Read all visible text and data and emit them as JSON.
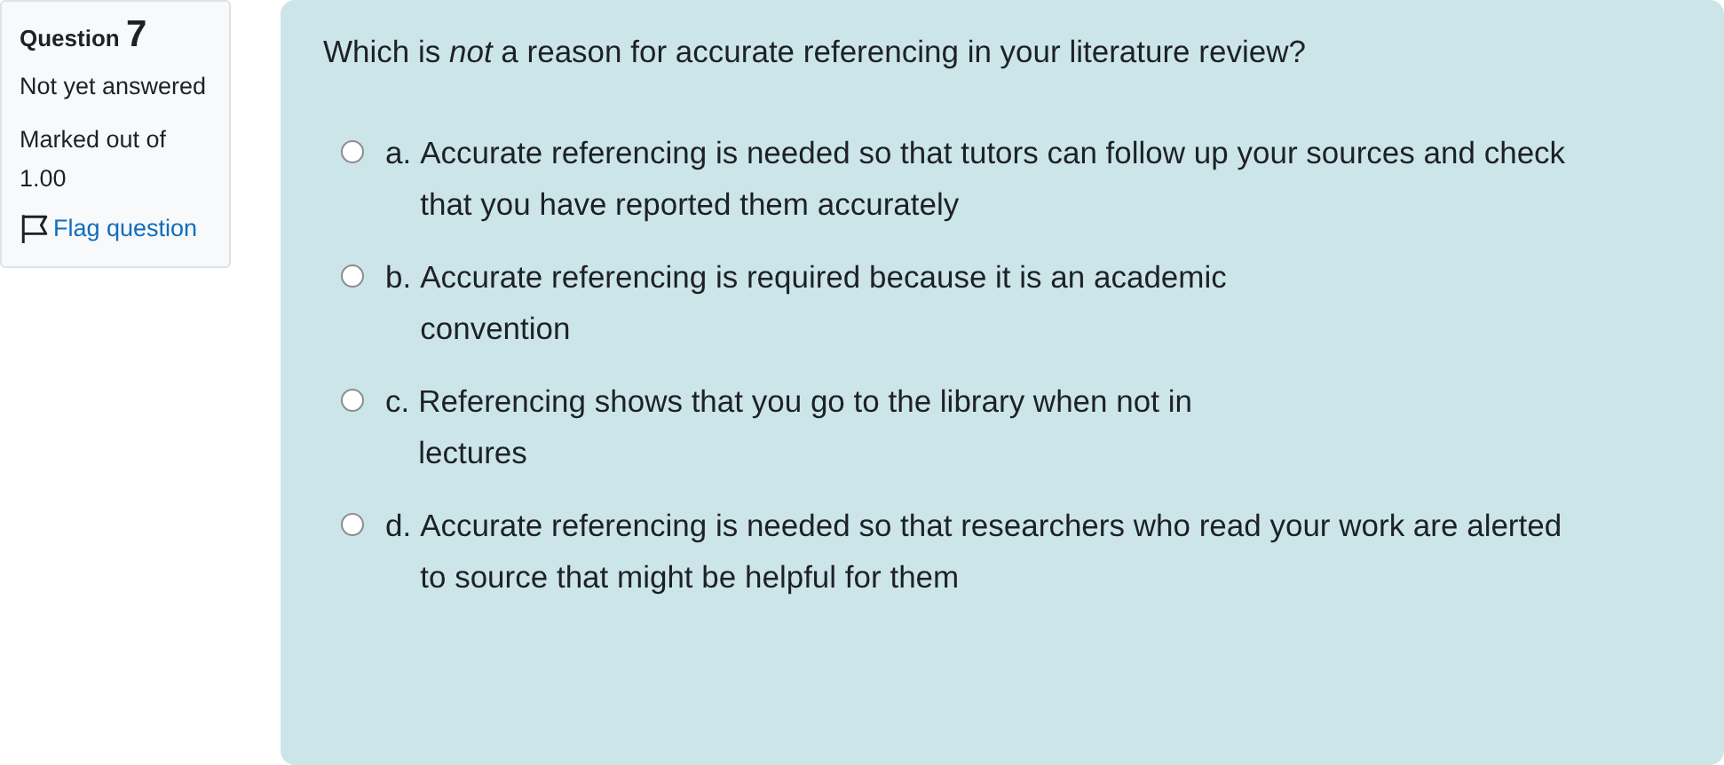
{
  "info": {
    "label": "Question",
    "number": "7",
    "state": "Not yet answered",
    "grade": "Marked out of 1.00",
    "flag": {
      "label": "Flag question",
      "flagged": false
    }
  },
  "question": {
    "text": "Which is *not* a reason for accurate referencing in your literature review?",
    "options": [
      {
        "letter": "a.",
        "lines": [
          "Accurate referencing is needed so that tutors can follow up your sources and check",
          "that you have reported them accurately"
        ],
        "selected": false
      },
      {
        "letter": "b.",
        "lines": [
          "Accurate referencing is required because it is an academic",
          "convention"
        ],
        "selected": false
      },
      {
        "letter": "c.",
        "lines": [
          "Referencing shows that you go to the library when not in",
          "lectures"
        ],
        "selected": false
      },
      {
        "letter": "d.",
        "lines": [
          "Accurate referencing is needed so that researchers who read your work are alerted",
          "to source that might be helpful for them"
        ],
        "selected": false
      }
    ]
  }
}
